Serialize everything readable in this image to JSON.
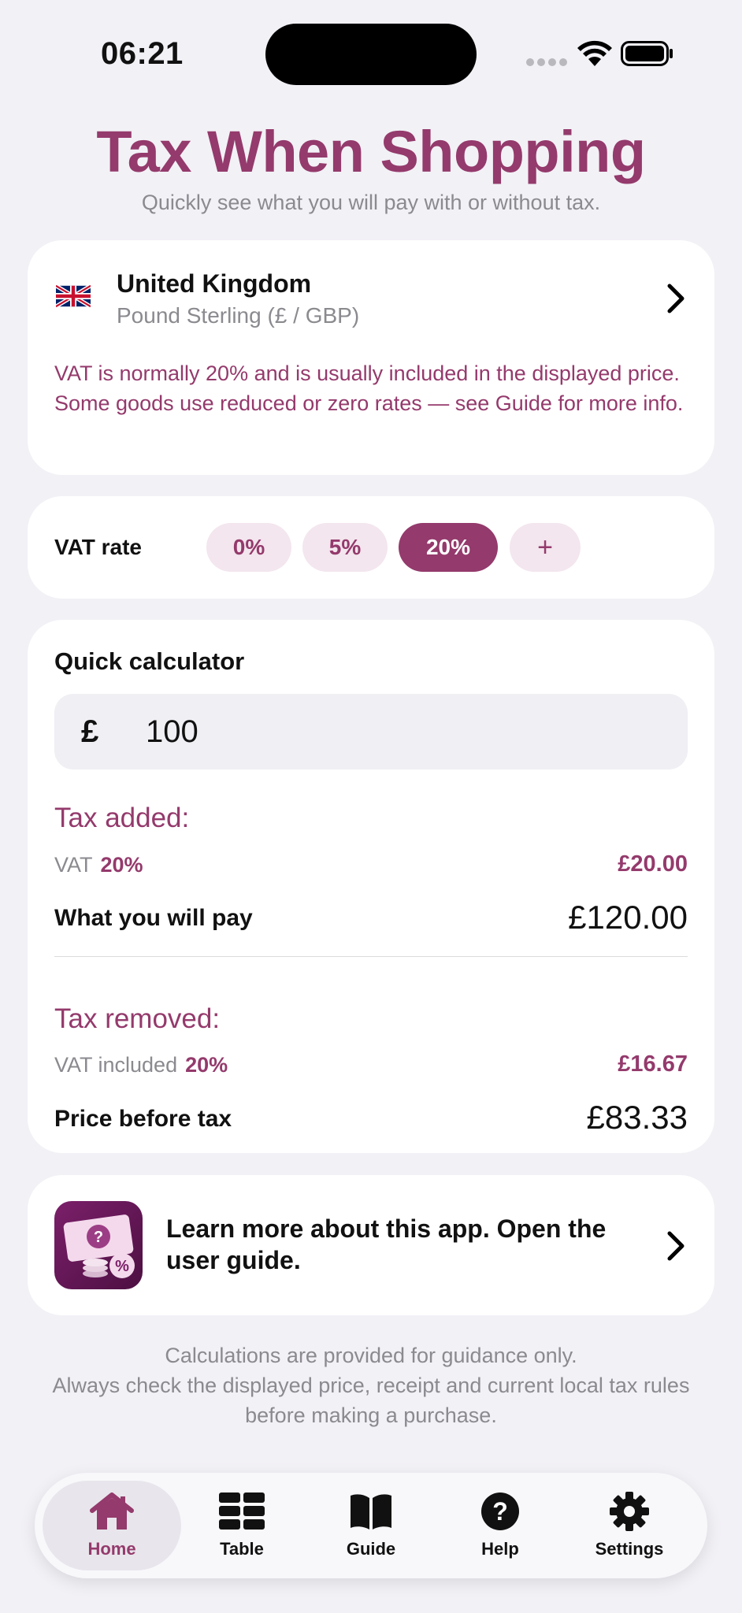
{
  "status_bar": {
    "time": "06:21"
  },
  "header": {
    "title": "Tax When Shopping",
    "subtitle": "Quickly see what you will pay with or without tax."
  },
  "country": {
    "name": "United Kingdom",
    "currency": "Pound Sterling (£ / GBP)",
    "flag_icon": "uk-flag-icon",
    "note": "VAT is normally 20% and is usually included in the displayed price. Some goods use reduced or zero rates — see Guide for more info."
  },
  "vat_rate": {
    "label": "VAT rate",
    "options": [
      "0%",
      "5%",
      "20%"
    ],
    "selected": "20%",
    "add_label": "+"
  },
  "calculator": {
    "title": "Quick calculator",
    "currency_symbol": "£",
    "amount": "100",
    "tax_added": {
      "title": "Tax added:",
      "vat_label": "VAT",
      "vat_rate": "20%",
      "vat_amount": "£20.00",
      "total_label": "What you will pay",
      "total_value": "£120.00"
    },
    "tax_removed": {
      "title": "Tax removed:",
      "vat_label": "VAT included",
      "vat_rate": "20%",
      "vat_amount": "£16.67",
      "total_label": "Price before tax",
      "total_value": "£83.33"
    }
  },
  "guide": {
    "text": "Learn more about this app. Open the user guide.",
    "icon": "app-guide-icon"
  },
  "disclaimer": {
    "line1": "Calculations are provided for guidance only.",
    "line2": "Always check the displayed price, receipt and current local tax rules before making a purchase."
  },
  "tabs": [
    {
      "label": "Home",
      "icon": "home-icon",
      "active": true
    },
    {
      "label": "Table",
      "icon": "table-icon",
      "active": false
    },
    {
      "label": "Guide",
      "icon": "book-icon",
      "active": false
    },
    {
      "label": "Help",
      "icon": "help-icon",
      "active": false
    },
    {
      "label": "Settings",
      "icon": "gear-icon",
      "active": false
    }
  ],
  "colors": {
    "accent": "#943a6c",
    "chip_bg": "#f3e6ee",
    "background": "#f2f1f6"
  }
}
